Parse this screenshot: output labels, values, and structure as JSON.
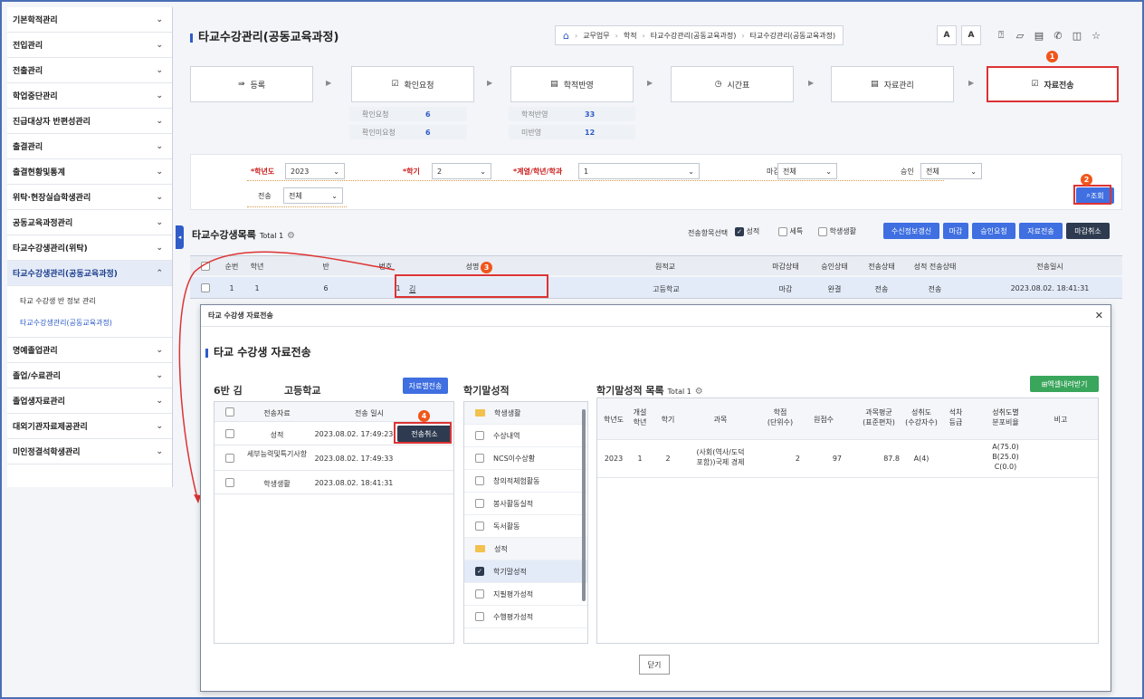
{
  "sidebar": {
    "items": [
      {
        "label": "기본학적관리"
      },
      {
        "label": "전입관리"
      },
      {
        "label": "전출관리"
      },
      {
        "label": "학업중단관리"
      },
      {
        "label": "진급대상자 반편성관리"
      },
      {
        "label": "출결관리"
      },
      {
        "label": "출결현황및통계"
      },
      {
        "label": "위탁·현장실습학생관리"
      },
      {
        "label": "공동교육과정관리"
      },
      {
        "label": "타교수강생관리(위탁)"
      },
      {
        "label": "타교수강생관리(공동교육과정)"
      }
    ],
    "sub": [
      "타교 수강생 반 정보 관리",
      "타교수강생관리(공동교육과정)"
    ],
    "items2": [
      {
        "label": "명예졸업관리"
      },
      {
        "label": "졸업/수료관리"
      },
      {
        "label": "졸업생자료관리"
      },
      {
        "label": "대외기관자료제공관리"
      },
      {
        "label": "미인정결석학생관리"
      }
    ]
  },
  "header": {
    "title": "타교수강관리(공동교육과정)",
    "breadcrumb": [
      "교무업무",
      "학적",
      "타교수강관리(공동교육과정)",
      "타교수강관리(공동교육과정)"
    ],
    "font_a": "A",
    "font_b": "A"
  },
  "steps": [
    "등록",
    "확인요청",
    "학적반영",
    "시간표",
    "자료관리",
    "자료전송"
  ],
  "stats": {
    "confirm_req_label": "확인요청",
    "confirm_req": "6",
    "confirm_unreq_label": "확인미요청",
    "confirm_unreq": "6",
    "reflected_label": "학적반영",
    "reflected": "33",
    "unreflected_label": "미반영",
    "unreflected": "12"
  },
  "filter": {
    "year_label": "*학년도",
    "year": "2023",
    "term_label": "*학기",
    "term": "2",
    "dept_label": "*계열/학년/학과",
    "dept": "1",
    "close_label": "마감",
    "close": "전체",
    "approve_label": "승인",
    "approve": "전체",
    "send_label": "전송",
    "send": "전체",
    "search_btn": "조회"
  },
  "list": {
    "title": "타교수강생목록",
    "total": "Total 1",
    "send_items_label": "전송항목선택",
    "opt_grade": "성적",
    "opt_detail": "세특",
    "opt_life": "학생생활",
    "buttons": [
      "수신정보갱신",
      "마감",
      "승인요청",
      "자료전송",
      "마감취소"
    ],
    "columns": [
      "순번",
      "학년",
      "반",
      "번호",
      "성명",
      "원적교",
      "마감상태",
      "승인상태",
      "전송상태",
      "성적 전송상태",
      "전송일시"
    ],
    "rows": [
      {
        "seq": "1",
        "grade": "1",
        "class": "6",
        "num": "1",
        "name": "김",
        "school": "고등학교",
        "close": "마감",
        "approve": "완결",
        "send": "전송",
        "grade_send": "전송",
        "sent_at": "2023.08.02. 18:41:31"
      }
    ]
  },
  "modal": {
    "title": "타교 수강생 자료전송",
    "subtitle": "타교 수강생 자료전송",
    "student_class": "6반 김",
    "student_school": "고등학교",
    "send_by_data": "자료별전송",
    "left_cols": [
      "전송자료",
      "전송 일시"
    ],
    "left_rows": [
      {
        "name": "성적",
        "at": "2023.08.02. 17:49:23",
        "action": "전송취소"
      },
      {
        "name": "세부능력및특기사항",
        "at": "2023.08.02. 17:49:33",
        "action": ""
      },
      {
        "name": "학생생활",
        "at": "2023.08.02. 18:41:31",
        "action": ""
      }
    ],
    "mid_title": "학기말성적",
    "tree": [
      {
        "label": "학생생활",
        "group": true,
        "checked": false
      },
      {
        "label": "수상내역",
        "group": false,
        "checked": false
      },
      {
        "label": "NCS이수상황",
        "group": false,
        "checked": false
      },
      {
        "label": "창의적체험활동",
        "group": false,
        "checked": false
      },
      {
        "label": "봉사활동실적",
        "group": false,
        "checked": false
      },
      {
        "label": "독서활동",
        "group": false,
        "checked": false
      },
      {
        "label": "성적",
        "group": true,
        "checked": false
      },
      {
        "label": "학기말성적",
        "group": false,
        "checked": true
      },
      {
        "label": "지필평가성적",
        "group": false,
        "checked": false
      },
      {
        "label": "수행평가성적",
        "group": false,
        "checked": false
      }
    ],
    "right_title": "학기말성적 목록",
    "right_total": "Total 1",
    "excel": "엑셀내려받기",
    "right_cols": [
      "학년도",
      "개설\n학년",
      "학기",
      "과목",
      "학점\n(단위수)",
      "원점수",
      "과목평균\n(표준편차)",
      "성취도\n(수강자수)",
      "석차\n등급",
      "성취도별\n분포비율",
      "비고"
    ],
    "right_row": {
      "year": "2023",
      "grade": "1",
      "term": "2",
      "subject": "(사회(역사/도덕\n포함))국제 경제",
      "credit": "2",
      "score": "97",
      "avg": "87.8",
      "achieve": "A(4)",
      "rank": "",
      "dist": "A(75.0)\nB(25.0)\nC(0.0)",
      "note": ""
    },
    "close": "닫기"
  },
  "markers": [
    "1",
    "2",
    "3",
    "4"
  ]
}
